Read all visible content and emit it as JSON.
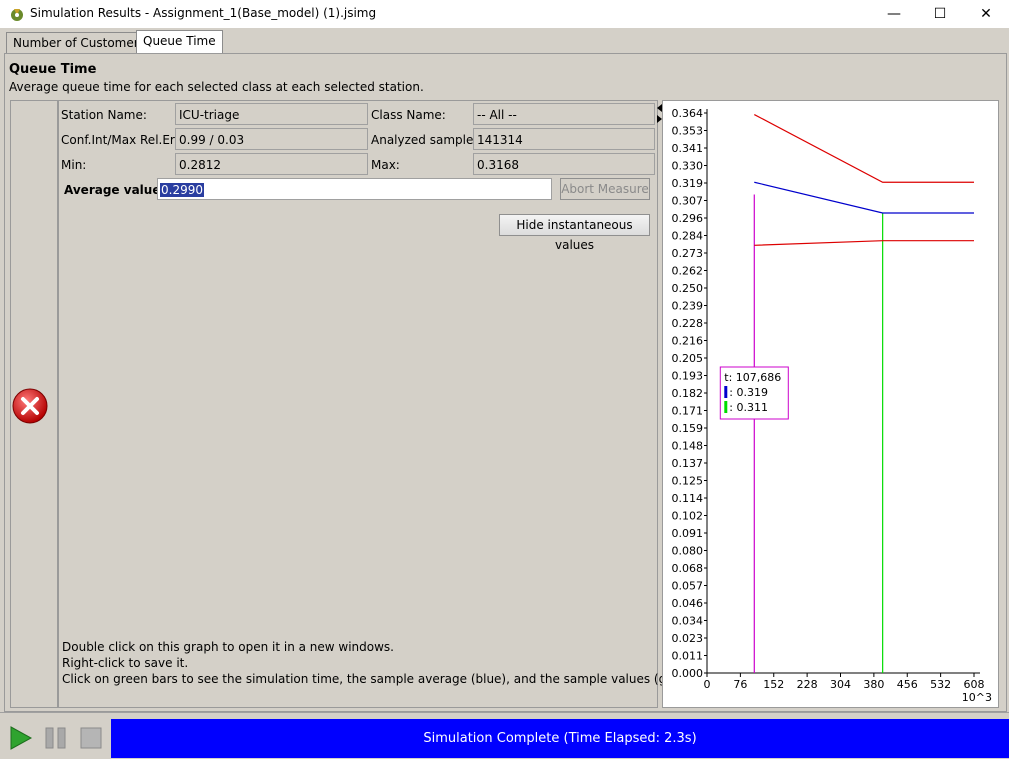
{
  "window": {
    "title": "Simulation Results - Assignment_1(Base_model) (1).jsimg",
    "minimize": "—",
    "maximize": "☐",
    "close": "✕"
  },
  "tabs": [
    {
      "label": "Number of Customers"
    },
    {
      "label": "Queue Time"
    }
  ],
  "header": {
    "title": "Queue Time",
    "subtitle": "Average queue time for each selected class at each selected station."
  },
  "form": {
    "station_name_label": "Station Name:",
    "station_name_value": "ICU-triage",
    "class_name_label": "Class Name:",
    "class_name_value": "-- All --",
    "conf_label": "Conf.Int/Max Rel.Err:",
    "conf_value": "0.99 / 0.03",
    "analyzed_label": "Analyzed samples:",
    "analyzed_value": "141314",
    "min_label": "Min:",
    "min_value": "0.2812",
    "max_label": "Max:",
    "max_value": "0.3168",
    "average_label": "Average value:",
    "average_value": "0.2990",
    "abort_button": "Abort Measure",
    "hide_button": "Hide instantaneous values"
  },
  "hints": [
    "Double click on this graph to open it in a new windows.",
    "Right-click to save it.",
    "Click on green bars to see the simulation time, the sample average (blue), and the sample values (green)."
  ],
  "status": {
    "text": "Simulation Complete (Time Elapsed: 2.3s)"
  },
  "colors": {
    "status_bar": "#0000ff",
    "mean_line": "#0000cc",
    "ci_lines": "#dd0000",
    "sample_bars": "#00dd00",
    "cursor_line": "#cc00cc"
  },
  "chart_data": {
    "type": "line",
    "x_ticks": [
      "0",
      "76",
      "152",
      "228",
      "304",
      "380",
      "456",
      "532",
      "608"
    ],
    "x_unit": "10^3",
    "y_ticks": [
      "0.000",
      "0.011",
      "0.023",
      "0.034",
      "0.046",
      "0.057",
      "0.068",
      "0.080",
      "0.091",
      "0.102",
      "0.114",
      "0.125",
      "0.137",
      "0.148",
      "0.159",
      "0.171",
      "0.182",
      "0.193",
      "0.205",
      "0.216",
      "0.228",
      "0.239",
      "0.250",
      "0.262",
      "0.273",
      "0.284",
      "0.296",
      "0.307",
      "0.319",
      "0.330",
      "0.341",
      "0.353",
      "0.364"
    ],
    "xlim": [
      0,
      608
    ],
    "ylim": [
      0,
      0.364
    ],
    "series": [
      {
        "role": "upper",
        "x": [
          107.686,
          400,
          608
        ],
        "y": [
          0.363,
          0.319,
          0.319
        ]
      },
      {
        "role": "mean",
        "x": [
          107.686,
          400,
          608
        ],
        "y": [
          0.319,
          0.299,
          0.299
        ]
      },
      {
        "role": "lower",
        "x": [
          107.686,
          400,
          608
        ],
        "y": [
          0.278,
          0.281,
          0.281
        ]
      }
    ],
    "sample_bars": [
      {
        "x": 400,
        "y": 0.299
      }
    ],
    "cursor": {
      "x": 107.686,
      "y": 0.311
    },
    "tooltip": {
      "t": "t: 107,686",
      "mean": ": 0.319",
      "sample": ": 0.311"
    }
  }
}
